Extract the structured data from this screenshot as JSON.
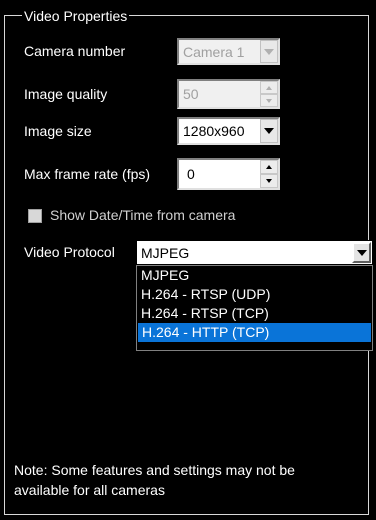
{
  "group": {
    "title": "Video Properties"
  },
  "camera_number": {
    "label": "Camera number",
    "value": "Camera 1",
    "enabled": false
  },
  "image_quality": {
    "label": "Image quality",
    "value": "50",
    "enabled": false
  },
  "image_size": {
    "label": "Image size",
    "value": "1280x960",
    "enabled": true
  },
  "max_frame_rate": {
    "label": "Max frame rate (fps)",
    "value": "0",
    "enabled": true
  },
  "show_datetime": {
    "label": "Show Date/Time from camera",
    "checked": false,
    "enabled": false
  },
  "video_protocol": {
    "label": "Video Protocol",
    "value": "MJPEG",
    "options": [
      "MJPEG",
      "H.264 - RTSP (UDP)",
      "H.264 - RTSP (TCP)",
      "H.264 - HTTP (TCP)"
    ],
    "highlighted_index": 3
  },
  "note": "Note: Some features and settings may not be available for all cameras",
  "colors": {
    "background": "#000000",
    "highlight": "#0a74d8"
  }
}
